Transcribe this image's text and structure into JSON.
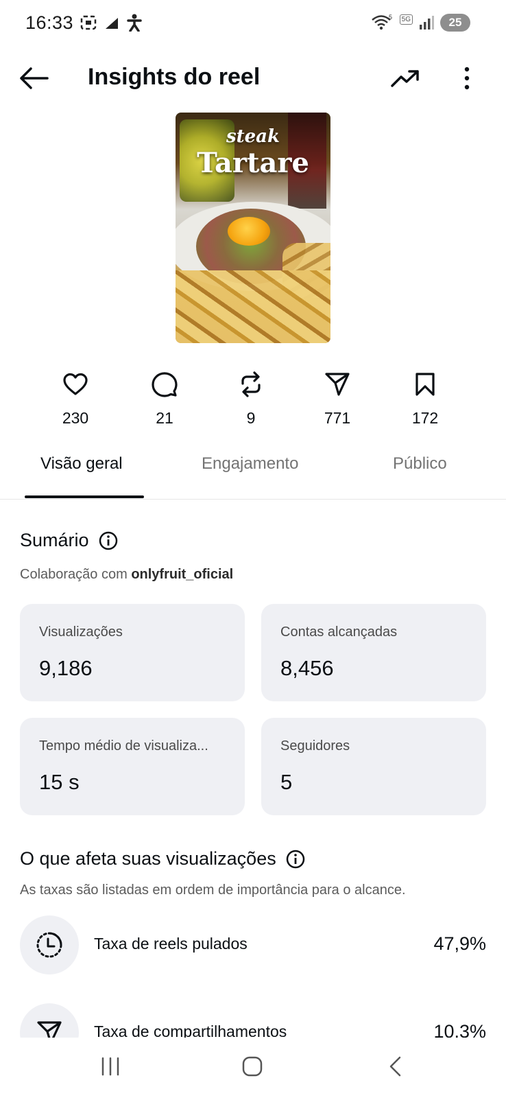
{
  "status_bar": {
    "time": "16:33",
    "battery": "25",
    "network": "5G",
    "wifi_badge": "5"
  },
  "header": {
    "title": "Insights do reel"
  },
  "thumbnail": {
    "overlay_small": "steak",
    "overlay_big": "Tartare"
  },
  "stats": [
    {
      "icon": "heart-icon",
      "value": "230"
    },
    {
      "icon": "comment-icon",
      "value": "21"
    },
    {
      "icon": "repost-icon",
      "value": "9"
    },
    {
      "icon": "share-icon",
      "value": "771"
    },
    {
      "icon": "bookmark-icon",
      "value": "172"
    }
  ],
  "tabs": [
    {
      "label": "Visão geral",
      "active": true
    },
    {
      "label": "Engajamento",
      "active": false
    },
    {
      "label": "Público",
      "active": false
    }
  ],
  "summary": {
    "title": "Sumário",
    "collab_prefix": "Colaboração com ",
    "collab_user": "onlyfruit_oficial",
    "cards": [
      {
        "label": "Visualizações",
        "value": "9,186"
      },
      {
        "label": "Contas alcançadas",
        "value": "8,456"
      },
      {
        "label": "Tempo médio de visualiza...",
        "value": "15 s"
      },
      {
        "label": "Seguidores",
        "value": "5"
      }
    ]
  },
  "affects": {
    "title": "O que afeta suas visualizações",
    "subtitle": "As taxas são listadas em ordem de importância para o alcance.",
    "rates": [
      {
        "icon": "skip-timer-icon",
        "label": "Taxa de reels pulados",
        "value": "47,9%"
      },
      {
        "icon": "share-icon",
        "label": "Taxa de compartilhamentos",
        "value": "10.3%"
      }
    ]
  },
  "colors": {
    "text": "#0c1014",
    "muted": "#737373",
    "card_bg": "#eff0f4"
  }
}
